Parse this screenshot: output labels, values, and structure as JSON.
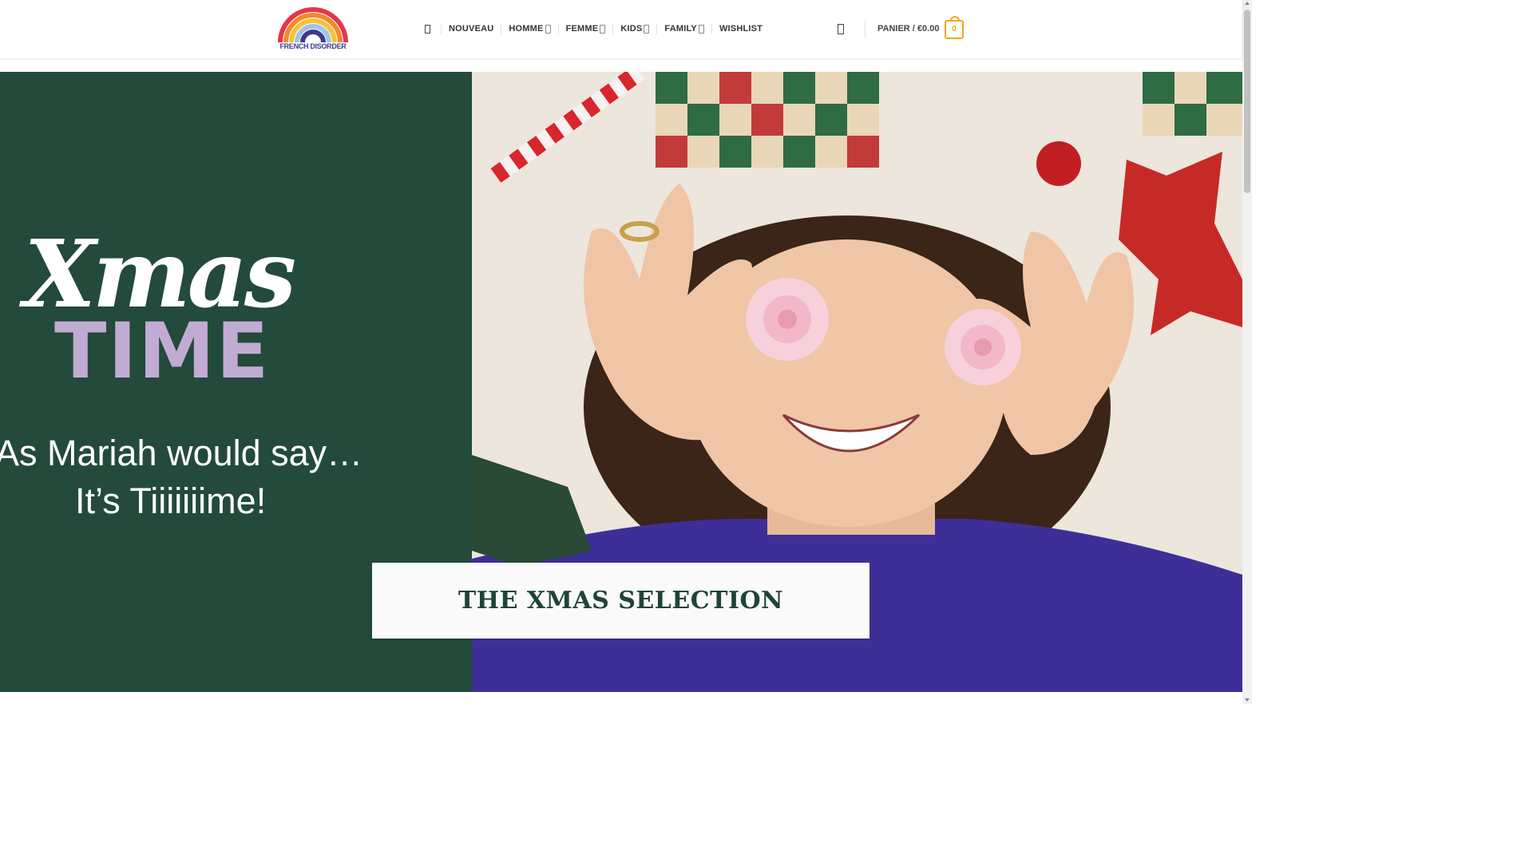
{
  "header": {
    "logo_text": "FRENCH DISORDER",
    "nav": [
      {
        "label": "NOUVEAU",
        "dropdown": false
      },
      {
        "label": "HOMME",
        "dropdown": true
      },
      {
        "label": "FEMME",
        "dropdown": true
      },
      {
        "label": "KIDS",
        "dropdown": true
      },
      {
        "label": "FAMILY",
        "dropdown": true
      },
      {
        "label": "WISHLIST",
        "dropdown": false
      }
    ],
    "cart_label": "PANIER / €0.00",
    "cart_count": "0",
    "icons": {
      "menu": "menu-icon",
      "search": "search-icon",
      "cart": "cart-icon",
      "dropdown": "chevron-down-icon"
    }
  },
  "hero": {
    "title_script": "Xmas",
    "title_block": "TIME",
    "line1": "As Mariah would say…",
    "line2": "It’s Tiiiiiiime!",
    "cta": "THE XMAS SELECTION"
  },
  "colors": {
    "hero_green": "#234a3b",
    "lilac": "#c2abd3",
    "accent_orange": "#f2a718",
    "logo_blue": "#3f3a8c",
    "sweater_purple": "#3e2f98"
  }
}
